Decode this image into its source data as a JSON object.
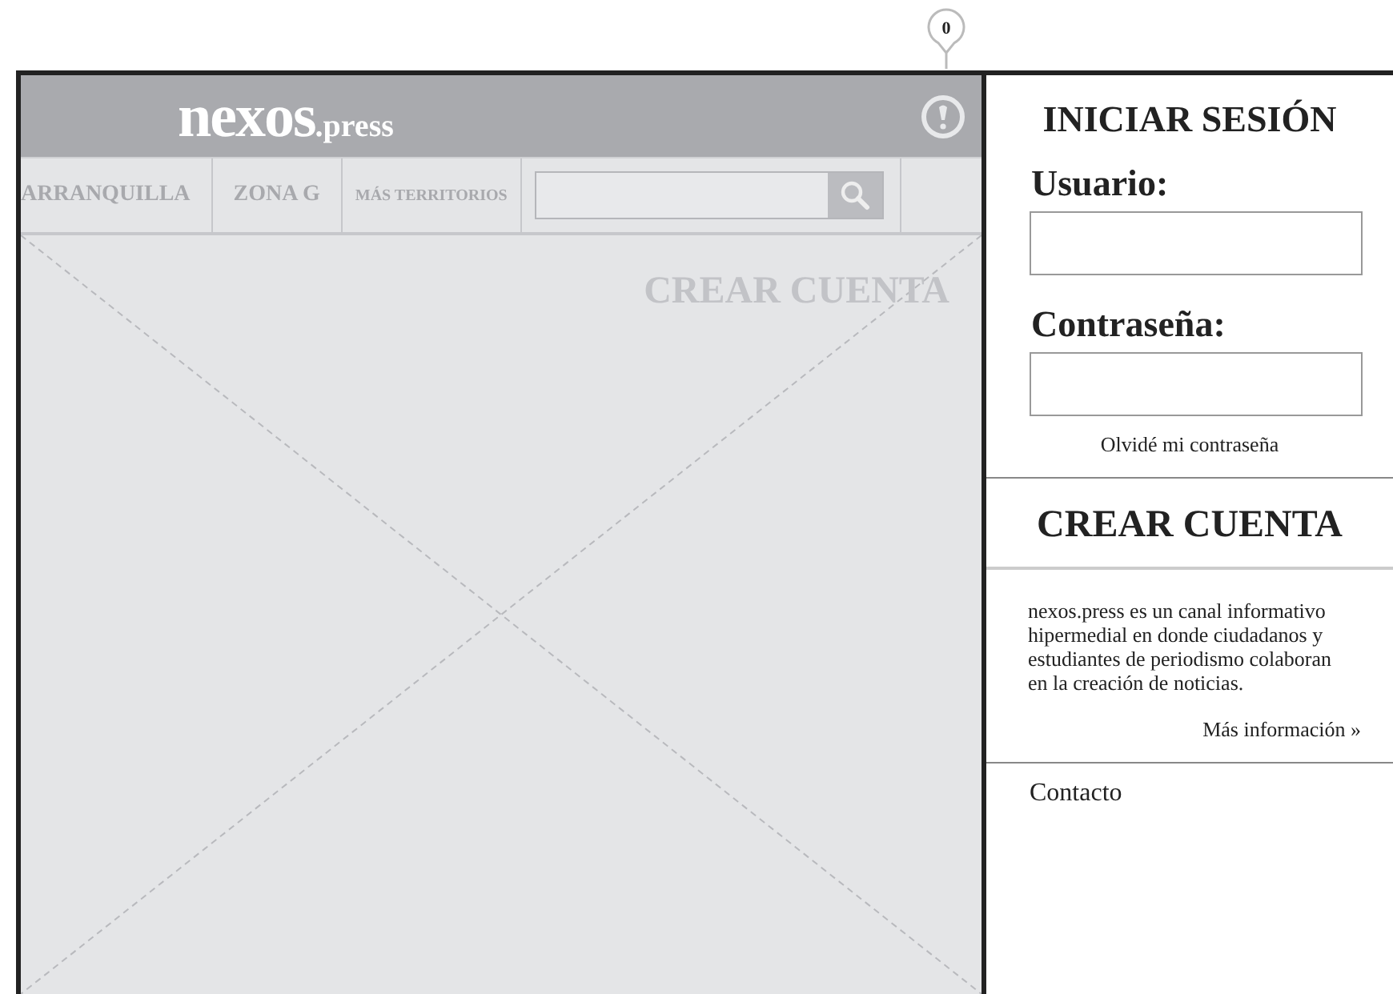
{
  "annotation": {
    "label": "0"
  },
  "header": {
    "logo": {
      "name": "nexos",
      "suffix": ".press"
    }
  },
  "nav": {
    "items": [
      {
        "label": "ARRANQUILLA",
        "kind": "large"
      },
      {
        "label": "ZONA G",
        "kind": "large"
      },
      {
        "label": "MÁS TERRITORIOS",
        "kind": "small"
      }
    ]
  },
  "content": {
    "heading": "CREAR CUENTA"
  },
  "login": {
    "title": "INICIAR SESIÓN",
    "fields": [
      {
        "label": "Usuario:"
      },
      {
        "label": "Contraseña:"
      }
    ],
    "forgot_link": "Olvidé mi contraseña"
  },
  "signup": {
    "title": "CREAR CUENTA",
    "description": "nexos.press es un canal informativo hipermedial en donde ciudadanos y estudiantes de periodismo colaboran en la creación de noticias.",
    "more_link": "Más información »"
  },
  "contact": {
    "label": "Contacto"
  }
}
